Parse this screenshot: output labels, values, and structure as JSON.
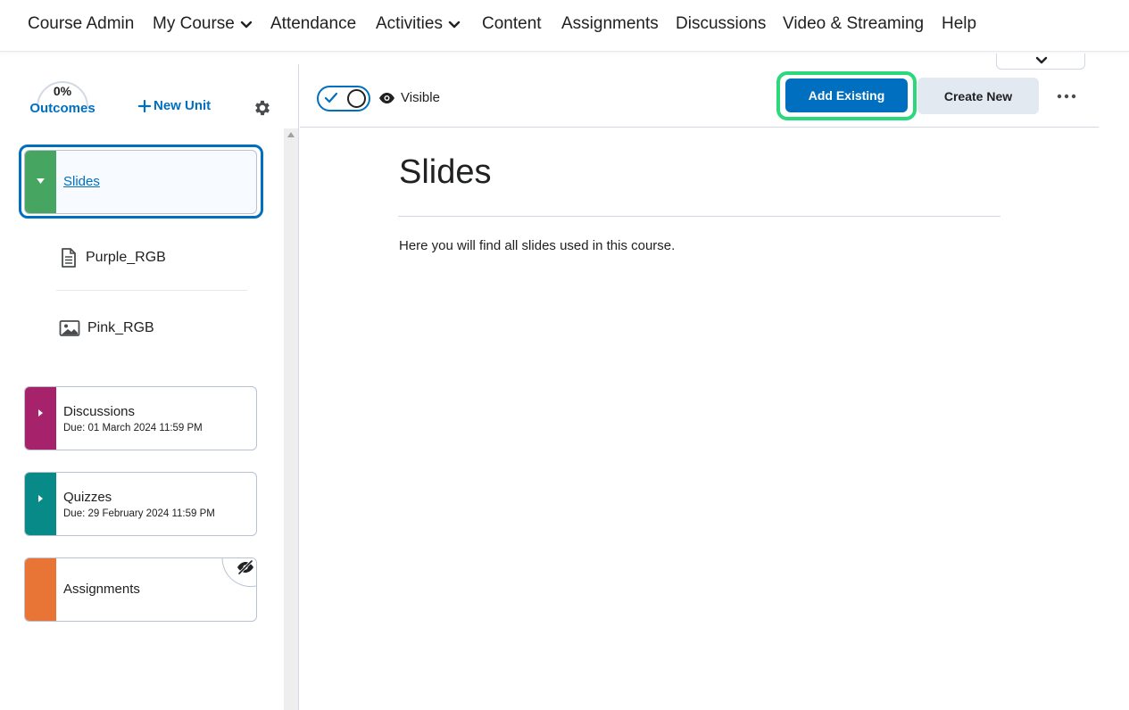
{
  "nav": {
    "items": [
      {
        "label": "Course Admin",
        "dropdown": false
      },
      {
        "label": "My Course",
        "dropdown": true
      },
      {
        "label": "Attendance",
        "dropdown": false
      },
      {
        "label": "Activities",
        "dropdown": true
      },
      {
        "label": "Content",
        "dropdown": false
      },
      {
        "label": "Assignments",
        "dropdown": false
      },
      {
        "label": "Discussions",
        "dropdown": false
      },
      {
        "label": "Video & Streaming",
        "dropdown": false
      },
      {
        "label": "Help",
        "dropdown": false
      }
    ]
  },
  "sidebar": {
    "outcomes_percent": "0%",
    "outcomes_label": "Outcomes",
    "new_unit_label": "New Unit",
    "units": [
      {
        "name": "Slides",
        "due": "",
        "color": "#46a661",
        "expanded": true,
        "hidden": false,
        "topics": [
          {
            "name": "Purple_RGB",
            "icon": "document-icon"
          },
          {
            "name": "Pink_RGB",
            "icon": "image-icon"
          }
        ]
      },
      {
        "name": "Discussions",
        "due": "Due: 01 March 2024 11:59 PM",
        "color": "#a6226a",
        "expanded": false,
        "hidden": false
      },
      {
        "name": "Quizzes",
        "due": "Due: 29 February 2024 11:59 PM",
        "color": "#088a88",
        "expanded": false,
        "hidden": false
      },
      {
        "name": "Assignments",
        "due": "",
        "color": "#e87536",
        "expanded": false,
        "hidden": true
      }
    ]
  },
  "toolbar": {
    "visibility_label": "Visible",
    "visibility_on": true,
    "add_existing_label": "Add Existing",
    "create_new_label": "Create New"
  },
  "main": {
    "title": "Slides",
    "description": "Here you will find all slides used in this course."
  },
  "colors": {
    "primary": "#006fbf",
    "highlight": "#2bd97c",
    "secondary_button": "#e3e9f1"
  }
}
